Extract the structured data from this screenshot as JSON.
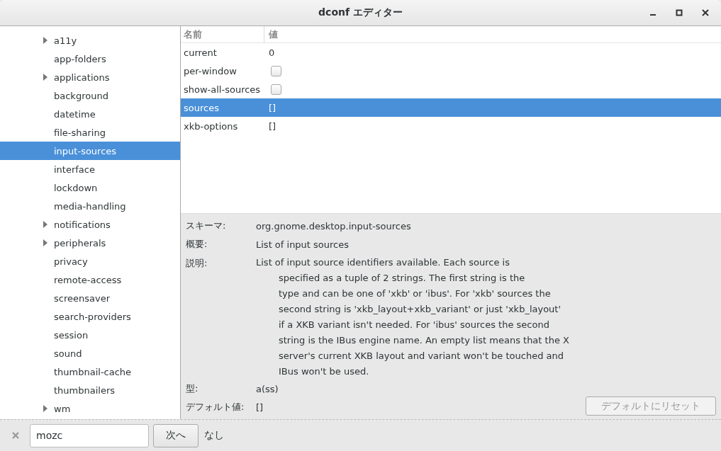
{
  "window": {
    "title": "dconf エディター"
  },
  "tree": [
    {
      "label": "a11y",
      "expandable": true,
      "selected": false
    },
    {
      "label": "app-folders",
      "expandable": false,
      "selected": false
    },
    {
      "label": "applications",
      "expandable": true,
      "selected": false
    },
    {
      "label": "background",
      "expandable": false,
      "selected": false
    },
    {
      "label": "datetime",
      "expandable": false,
      "selected": false
    },
    {
      "label": "file-sharing",
      "expandable": false,
      "selected": false
    },
    {
      "label": "input-sources",
      "expandable": false,
      "selected": true
    },
    {
      "label": "interface",
      "expandable": false,
      "selected": false
    },
    {
      "label": "lockdown",
      "expandable": false,
      "selected": false
    },
    {
      "label": "media-handling",
      "expandable": false,
      "selected": false
    },
    {
      "label": "notifications",
      "expandable": true,
      "selected": false
    },
    {
      "label": "peripherals",
      "expandable": true,
      "selected": false
    },
    {
      "label": "privacy",
      "expandable": false,
      "selected": false
    },
    {
      "label": "remote-access",
      "expandable": false,
      "selected": false
    },
    {
      "label": "screensaver",
      "expandable": false,
      "selected": false
    },
    {
      "label": "search-providers",
      "expandable": false,
      "selected": false
    },
    {
      "label": "session",
      "expandable": false,
      "selected": false
    },
    {
      "label": "sound",
      "expandable": false,
      "selected": false
    },
    {
      "label": "thumbnail-cache",
      "expandable": false,
      "selected": false
    },
    {
      "label": "thumbnailers",
      "expandable": false,
      "selected": false
    },
    {
      "label": "wm",
      "expandable": true,
      "selected": false
    }
  ],
  "table": {
    "columns": [
      "名前",
      "値"
    ],
    "rows": [
      {
        "name": "current",
        "kind": "text",
        "value": "0",
        "selected": false
      },
      {
        "name": "per-window",
        "kind": "checkbox",
        "checked": false,
        "selected": false
      },
      {
        "name": "show-all-sources",
        "kind": "checkbox",
        "checked": false,
        "selected": false
      },
      {
        "name": "sources",
        "kind": "text",
        "value": "[]",
        "selected": true
      },
      {
        "name": "xkb-options",
        "kind": "text",
        "value": "[]",
        "selected": false
      }
    ]
  },
  "details": {
    "schema_label": "スキーマ:",
    "schema": "org.gnome.desktop.input-sources",
    "summary_label": "概要:",
    "summary": "List of input sources",
    "description_label": "説明:",
    "description_lines": [
      "List of input source identifiers available. Each source is",
      "specified as a tuple of 2 strings. The first string is the",
      "type and can be one of 'xkb' or 'ibus'. For 'xkb' sources the",
      "second string is 'xkb_layout+xkb_variant' or just 'xkb_layout'",
      "if a XKB variant isn't needed. For 'ibus' sources the second",
      "string is the IBus engine name. An empty list means that the X",
      "server's current XKB layout and variant won't be touched and",
      "IBus won't be used."
    ],
    "type_label": "型:",
    "type": "a(ss)",
    "default_label": "デフォルト値:",
    "default": "[]",
    "reset_button": {
      "label": "デフォルトにリセット",
      "disabled": true
    }
  },
  "search_bar": {
    "value": "mozc",
    "next_button": "次へ",
    "result": "なし"
  }
}
